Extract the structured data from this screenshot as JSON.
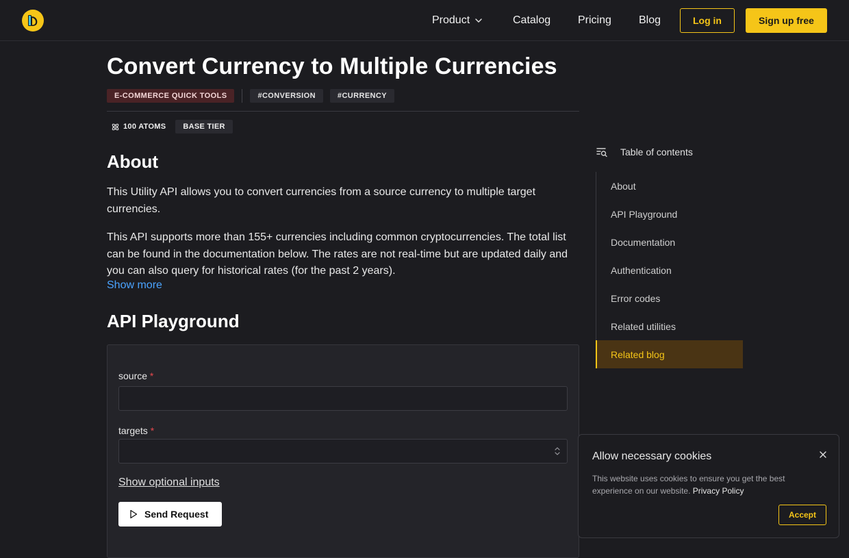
{
  "header": {
    "nav": {
      "product": "Product",
      "catalog": "Catalog",
      "pricing": "Pricing",
      "blog": "Blog"
    },
    "login": "Log in",
    "signup": "Sign up free"
  },
  "page": {
    "title": "Convert Currency to Multiple Currencies",
    "tags": {
      "category": "E-COMMERCE QUICK TOOLS",
      "tag1": "#CONVERSION",
      "tag2": "#CURRENCY"
    },
    "meta": {
      "atoms": "100 ATOMS",
      "tier": "BASE TIER"
    }
  },
  "about": {
    "heading": "About",
    "p1": "This Utility API allows you to convert currencies from a source currency to multiple target currencies.",
    "p2": "This API supports more than 155+ currencies including common cryptocurrencies. The total list can be found in the documentation below. The rates are not real-time but are updated daily and you can also query for historical rates (for the past 2 years).",
    "show_more": "Show more"
  },
  "playground": {
    "heading": "API Playground",
    "source_label": "source",
    "source_value": "",
    "targets_label": "targets",
    "targets_value": "",
    "required_mark": "*",
    "optional_link": "Show optional inputs",
    "send_label": "Send Request"
  },
  "toc": {
    "heading": "Table of contents",
    "items": [
      "About",
      "API Playground",
      "Documentation",
      "Authentication",
      "Error codes",
      "Related utilities",
      "Related blog"
    ],
    "active": "Related blog"
  },
  "cookie": {
    "title": "Allow necessary cookies",
    "text": "This website uses cookies to ensure you get the best experience on our website.",
    "link": "Privacy Policy",
    "accept": "Accept"
  },
  "colors": {
    "accent": "#f5c518",
    "link": "#4aa3ff",
    "background": "#1c1c20",
    "required": "#e5484d"
  },
  "icons": {
    "logo": "brand-logo-icon",
    "product_dropdown": "chevron-down-icon",
    "atoms": "atom-icon",
    "send": "play-icon",
    "toc": "list-search-icon",
    "targets_select": "chevron-updown-icon",
    "cookie_close": "close-icon"
  }
}
